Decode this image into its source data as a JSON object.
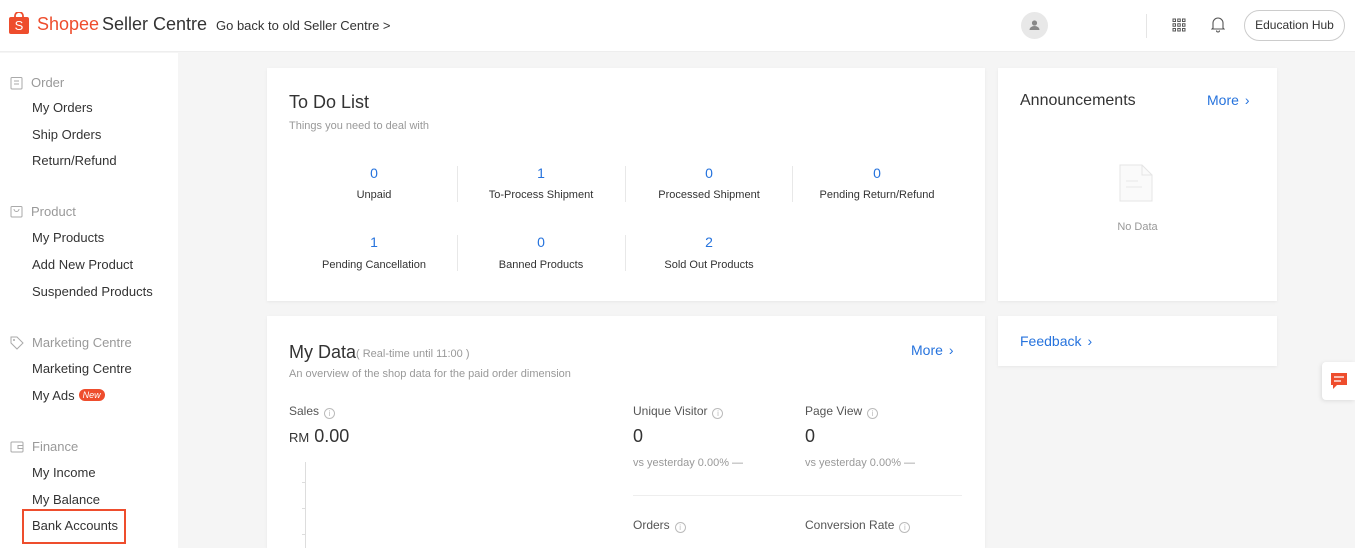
{
  "header": {
    "logo_text": "Shopee",
    "logo_suffix": "Seller Centre",
    "back_link": "Go back to old Seller Centre >",
    "education_hub": "Education Hub"
  },
  "sidebar": {
    "sections": [
      {
        "title": "Order",
        "icon": "clipboard-icon",
        "items": [
          "My Orders",
          "Ship Orders",
          "Return/Refund"
        ]
      },
      {
        "title": "Product",
        "icon": "bag-icon",
        "items": [
          "My Products",
          "Add New Product",
          "Suspended Products"
        ]
      },
      {
        "title": "Marketing Centre",
        "icon": "tag-icon",
        "items": [
          "Marketing Centre",
          "My Ads"
        ]
      },
      {
        "title": "Finance",
        "icon": "wallet-icon",
        "items": [
          "My Income",
          "My Balance",
          "Bank Accounts"
        ]
      }
    ],
    "new_badge": "New"
  },
  "todo": {
    "title": "To Do List",
    "subtitle": "Things you need to deal with",
    "items": [
      {
        "count": "0",
        "label": "Unpaid"
      },
      {
        "count": "1",
        "label": "To-Process Shipment"
      },
      {
        "count": "0",
        "label": "Processed Shipment"
      },
      {
        "count": "0",
        "label": "Pending Return/Refund"
      },
      {
        "count": "1",
        "label": "Pending Cancellation"
      },
      {
        "count": "0",
        "label": "Banned Products"
      },
      {
        "count": "2",
        "label": "Sold Out Products"
      }
    ]
  },
  "announcements": {
    "title": "Announcements",
    "more": "More",
    "empty": "No Data"
  },
  "feedback": {
    "label": "Feedback"
  },
  "mydata": {
    "title": "My Data",
    "realtime": "( Real-time until 11:00 )",
    "subtitle": "An overview of the shop data for the paid order dimension",
    "more": "More",
    "sales_label": "Sales",
    "sales_currency": "RM",
    "sales_value": "0.00",
    "unique_visitor_label": "Unique Visitor",
    "unique_visitor_value": "0",
    "unique_visitor_cmp": "vs yesterday 0.00% —",
    "page_view_label": "Page View",
    "page_view_value": "0",
    "page_view_cmp": "vs yesterday 0.00% —",
    "orders_label": "Orders",
    "conversion_label": "Conversion Rate"
  },
  "colors": {
    "brand": "#ee4d2d",
    "link": "#2673dd"
  }
}
